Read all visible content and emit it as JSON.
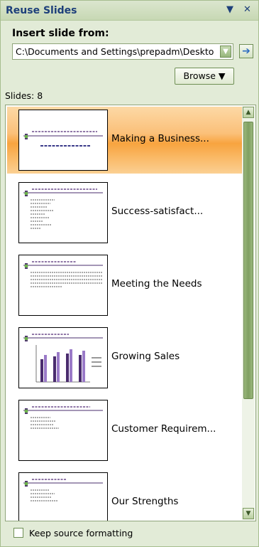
{
  "pane": {
    "title": "Reuse Slides",
    "dropdown_glyph": "▼",
    "close_glyph": "✕"
  },
  "insert": {
    "label": "Insert slide from:",
    "path": "C:\\Documents and Settings\\prepadm\\Desktop",
    "go_glyph": "➔"
  },
  "browse": {
    "label": "Browse ▼"
  },
  "slides": {
    "count_label": "Slides: 8",
    "items": [
      {
        "label": "Making a Business...",
        "selected": true
      },
      {
        "label": "Success-satisfact..."
      },
      {
        "label": "Meeting the Needs"
      },
      {
        "label": "Growing Sales"
      },
      {
        "label": "Customer Requirem..."
      },
      {
        "label": "Our Strengths"
      }
    ]
  },
  "scrollbar": {
    "up": "▲",
    "down": "▼"
  },
  "keep_source": {
    "label": "Keep source formatting",
    "checked": false
  }
}
